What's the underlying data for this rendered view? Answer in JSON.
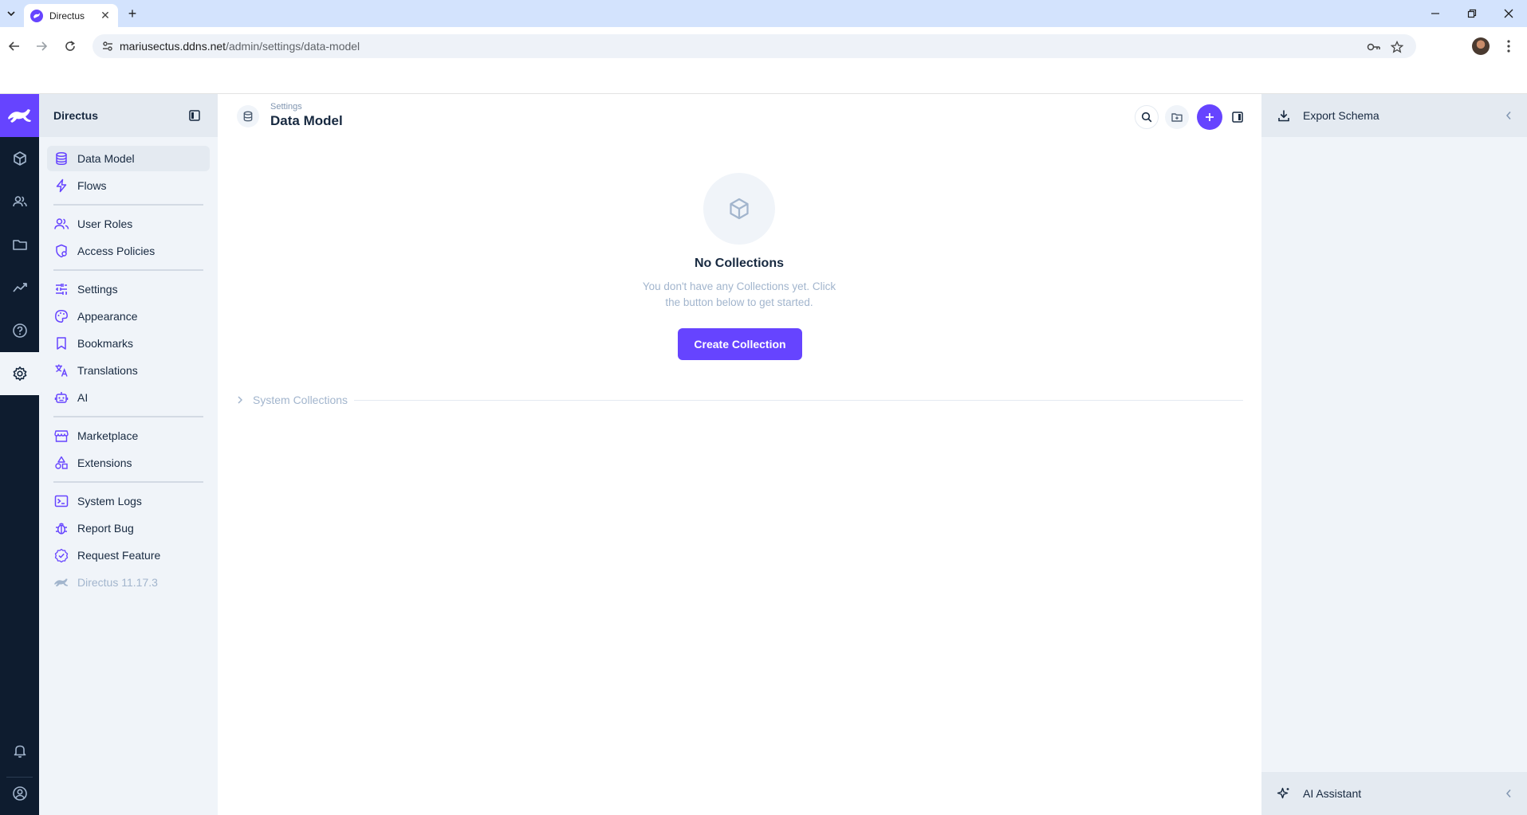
{
  "browser": {
    "tab_title": "Directus",
    "url_host": "mariusectus.ddns.net",
    "url_path": "/admin/settings/data-model"
  },
  "modules": [
    {
      "name": "content",
      "icon": "box-icon"
    },
    {
      "name": "users",
      "icon": "users-icon"
    },
    {
      "name": "files",
      "icon": "folder-icon"
    },
    {
      "name": "insights",
      "icon": "trending-icon"
    },
    {
      "name": "help",
      "icon": "help-icon"
    },
    {
      "name": "settings",
      "icon": "gear-icon",
      "active": true
    },
    {
      "name": "notifications",
      "icon": "bell-icon"
    },
    {
      "name": "profile",
      "icon": "account-icon"
    }
  ],
  "nav": {
    "title": "Directus",
    "items": [
      {
        "label": "Data Model",
        "icon": "database-icon",
        "active": true
      },
      {
        "label": "Flows",
        "icon": "bolt-icon"
      },
      {
        "label": "User Roles",
        "icon": "group-icon"
      },
      {
        "label": "Access Policies",
        "icon": "policy-icon"
      },
      {
        "label": "Settings",
        "icon": "sliders-icon"
      },
      {
        "label": "Appearance",
        "icon": "palette-icon"
      },
      {
        "label": "Bookmarks",
        "icon": "bookmark-icon"
      },
      {
        "label": "Translations",
        "icon": "translate-icon"
      },
      {
        "label": "AI",
        "icon": "robot-icon"
      },
      {
        "label": "Marketplace",
        "icon": "store-icon"
      },
      {
        "label": "Extensions",
        "icon": "shapes-icon"
      },
      {
        "label": "System Logs",
        "icon": "terminal-icon"
      },
      {
        "label": "Report Bug",
        "icon": "bug-icon"
      },
      {
        "label": "Request Feature",
        "icon": "check-badge-icon"
      },
      {
        "label": "Directus 11.17.3",
        "icon": "directus-icon"
      }
    ]
  },
  "header": {
    "kicker": "Settings",
    "title": "Data Model"
  },
  "empty": {
    "title": "No Collections",
    "text": "You don't have any Collections yet. Click the button below to get started.",
    "button": "Create Collection"
  },
  "system_collections": "System Collections",
  "sidebar": {
    "export_label": "Export Schema",
    "ai_label": "AI Assistant"
  },
  "colors": {
    "primary": "#6644ff",
    "module_bar": "#0e1c2f",
    "nav_bg": "#f0f4f9",
    "muted_text": "#a2b5cd"
  }
}
